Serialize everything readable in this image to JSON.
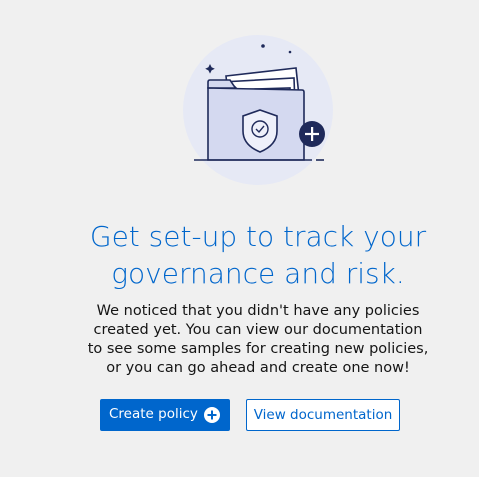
{
  "empty_state": {
    "heading_lines": [
      "Get set-up to track your",
      "governance and risk."
    ],
    "body_lines": [
      "We noticed that you didn't have any policies",
      "created yet. You can view our documentation",
      "to see some samples for creating new policies,",
      "or you can go ahead and create one now!"
    ],
    "primary_action": "Create policy",
    "secondary_action": "View documentation",
    "primary_icon": "plus-circle-icon",
    "illustration_icon": "folder-shield-icon"
  },
  "colors": {
    "accent": "#0066cc",
    "background": "#f0f0f0",
    "text": "#151515",
    "illustration_circle": "#e6e9f5",
    "illustration_stroke": "#1f2a5a"
  }
}
